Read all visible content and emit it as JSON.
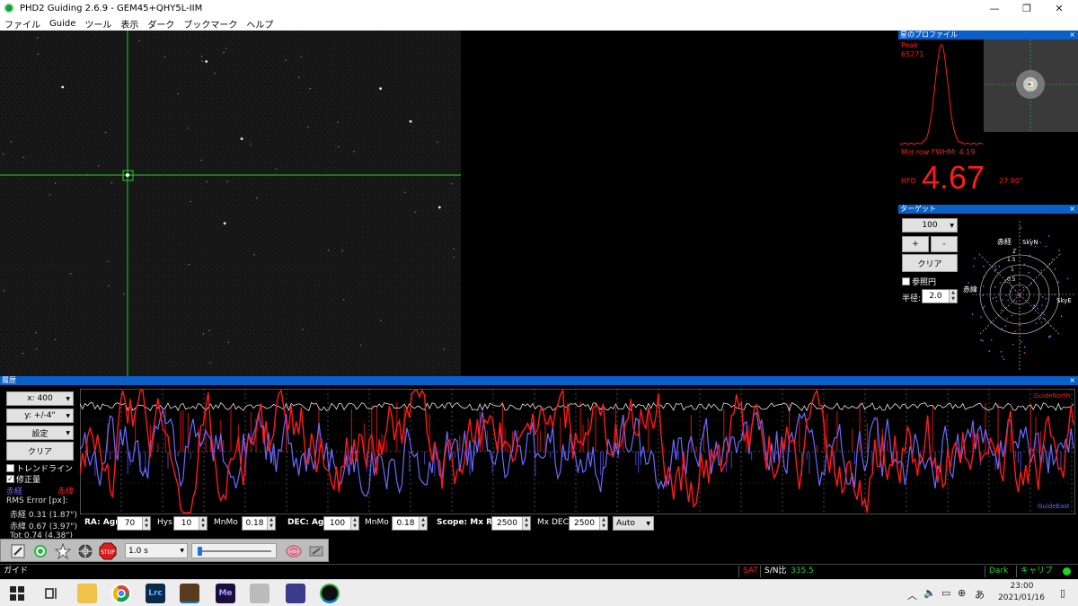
{
  "window": {
    "title": "PHD2 Guiding 2.6.9 - GEM45+QHY5L-IIM",
    "minimize": "—",
    "restore": "❐",
    "close": "✕"
  },
  "menu": [
    "ファイル",
    "Guide",
    "ツール",
    "表示",
    "ダーク",
    "ブックマーク",
    "ヘルプ"
  ],
  "profile": {
    "header": "星のプロファイル",
    "close": "×",
    "peak_label": "Peak",
    "peak_value": "65271",
    "fwhm": "Mid row FWHM: 4.19",
    "hfd_label": "HFD",
    "hfd_value": "4.67",
    "hfd_arcsec": "27.80\""
  },
  "target": {
    "header": "ターゲット",
    "close": "×",
    "zoom": "100",
    "plus": "+",
    "minus": "-",
    "clear": "クリア",
    "ref_circle": "参照円",
    "radius_label": "半径:",
    "radius_value": "2.0",
    "ra_label": "赤経",
    "dec_label": "赤緯",
    "skyn": "SkyN",
    "skye": "SkyE",
    "ring_labels": [
      "2",
      "1.5",
      "1",
      "0.5"
    ]
  },
  "history": {
    "header": "履歴",
    "close": "×",
    "x_scale": "x: 400",
    "y_scale": "y: +/-4\"",
    "settings": "設定",
    "clear": "クリア",
    "trendline": "トレンドライン",
    "correction": "修正量",
    "ra_legend": "赤経",
    "dec_legend": "赤緯",
    "rms_title": "RMS Error [px]:",
    "rms_ra": "赤経 0.31 (1.87\")",
    "rms_dec": "赤緯 0.67 (3.97\")",
    "rms_tot": "Tot 0.74 (4.38\")",
    "guide_north": "GuideNorth",
    "guide_east": "GuideEast",
    "ra_agr_label": "RA: Agr",
    "ra_agr": "70",
    "hys_label": "Hys",
    "hys": "10",
    "mnmo_label": "MnMo",
    "ra_mnmo": "0.18",
    "dec_agr_label": "DEC: Agr",
    "dec_agr": "100",
    "dec_mnmo": "0.18",
    "scope_label": "Scope: Mx RA",
    "mx_ra": "2500",
    "mx_dec_label": "Mx DEC",
    "mx_dec": "2500",
    "mode": "Auto"
  },
  "toolbar": {
    "exposure": "1.0 s",
    "stop": "STOP"
  },
  "status": {
    "left": "ガイド",
    "sat": "SAT",
    "snr_label": "S/N比",
    "snr": "335.5",
    "dark": "Dark",
    "calib": "キャリブ"
  },
  "clock": {
    "time": "23:00",
    "date": "2021/01/16"
  },
  "taskbar_apps": [
    "Lrc",
    "Me"
  ],
  "colors": {
    "ra": "#6a6aff",
    "dec": "#ff1a1a",
    "accent": "#0a60c9",
    "green": "#1ed41e"
  }
}
